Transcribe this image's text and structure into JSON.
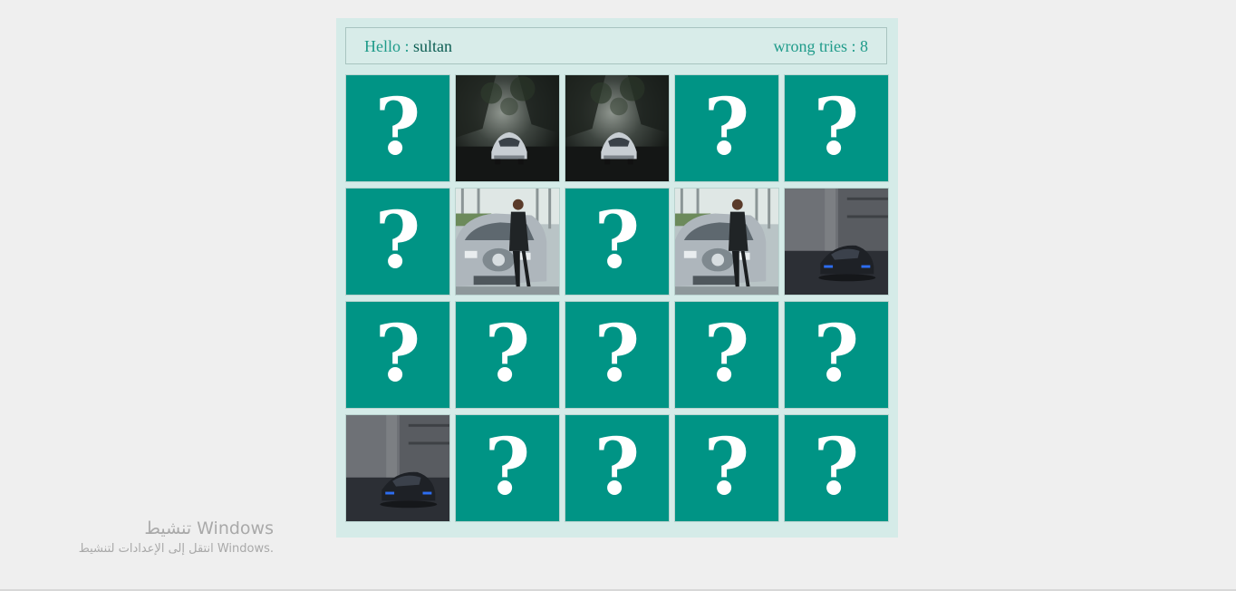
{
  "header": {
    "hello_label": "Hello : ",
    "player_name": "sultan",
    "wrong_tries_label": "wrong tries : ",
    "wrong_tries": "8"
  },
  "board": {
    "columns": 5,
    "rows": 4,
    "hidden_glyph": "?",
    "cards": [
      {
        "state": "hidden"
      },
      {
        "state": "revealed",
        "image": "silver-sports-car-forest"
      },
      {
        "state": "revealed",
        "image": "silver-sports-car-forest"
      },
      {
        "state": "hidden"
      },
      {
        "state": "hidden"
      },
      {
        "state": "hidden"
      },
      {
        "state": "revealed",
        "image": "silver-suv-with-woman"
      },
      {
        "state": "hidden"
      },
      {
        "state": "revealed",
        "image": "silver-suv-with-woman"
      },
      {
        "state": "revealed",
        "image": "black-concept-car-garage"
      },
      {
        "state": "hidden"
      },
      {
        "state": "hidden"
      },
      {
        "state": "hidden"
      },
      {
        "state": "hidden"
      },
      {
        "state": "hidden"
      },
      {
        "state": "revealed",
        "image": "black-concept-car-garage"
      },
      {
        "state": "hidden"
      },
      {
        "state": "hidden"
      },
      {
        "state": "hidden"
      },
      {
        "state": "hidden"
      }
    ]
  },
  "colors": {
    "card_back": "#009485",
    "panel": "#d5ebe8",
    "accent_text": "#1f9b8a"
  },
  "watermark": {
    "line1": "تنشيط Windows",
    "line2": "انتقل إلى الإعدادات لتنشيط Windows."
  }
}
